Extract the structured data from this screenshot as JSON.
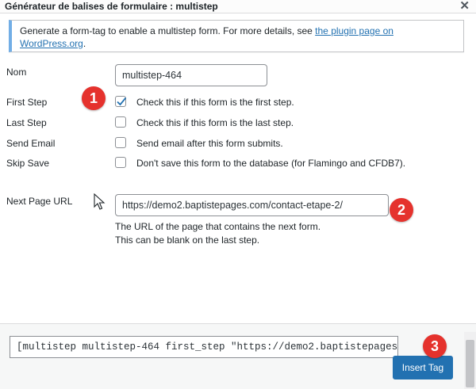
{
  "dialog": {
    "title": "Générateur de balises de formulaire : multistep",
    "close_symbol": "✕"
  },
  "notice": {
    "text": "Generate a form-tag to enable a multistep form. For more details, see ",
    "link_text": "the plugin page on WordPress.org",
    "suffix": "."
  },
  "fields": {
    "name": {
      "label": "Nom",
      "value": "multistep-464"
    },
    "first_step": {
      "label": "First Step",
      "text": "Check this if this form is the first step.",
      "checked": true
    },
    "last_step": {
      "label": "Last Step",
      "text": "Check this if this form is the last step.",
      "checked": false
    },
    "send_email": {
      "label": "Send Email",
      "text": "Send email after this form submits.",
      "checked": false
    },
    "skip_save": {
      "label": "Skip Save",
      "text": "Don't save this form to the database (for Flamingo and CFDB7).",
      "checked": false
    },
    "next_page_url": {
      "label": "Next Page URL",
      "value": "https://demo2.baptistepages.com/contact-etape-2/",
      "hint_line1": "The URL of the page that contains the next form.",
      "hint_line2": "This can be blank on the last step."
    }
  },
  "badges": {
    "one": "1",
    "two": "2",
    "three": "3"
  },
  "footer": {
    "tag_value": "[multistep multistep-464 first_step \"https://demo2.baptistepages",
    "insert_label": "Insert Tag"
  },
  "colors": {
    "accent": "#2271b1",
    "notice_border": "#72aee6",
    "badge": "#e5322d"
  }
}
